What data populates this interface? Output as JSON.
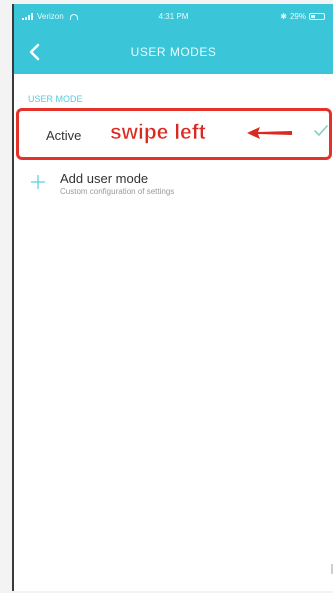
{
  "status_bar": {
    "carrier": "Verizon",
    "time": "4:31 PM",
    "battery": "29%"
  },
  "nav": {
    "title": "USER MODES"
  },
  "section": {
    "header": "USER MODE"
  },
  "active_mode": {
    "label": "Active",
    "annotation": "swipe left",
    "selected": true
  },
  "add_mode": {
    "label": "Add user mode",
    "subtitle": "Custom configuration of settings"
  },
  "colors": {
    "accent": "#3bc5d8",
    "annotation_red": "#e4322b",
    "check_green": "#7fd3c6"
  },
  "icons": [
    "back-icon",
    "check-icon",
    "plus-icon",
    "arrow-left-icon",
    "wifi-icon",
    "battery-icon"
  ]
}
